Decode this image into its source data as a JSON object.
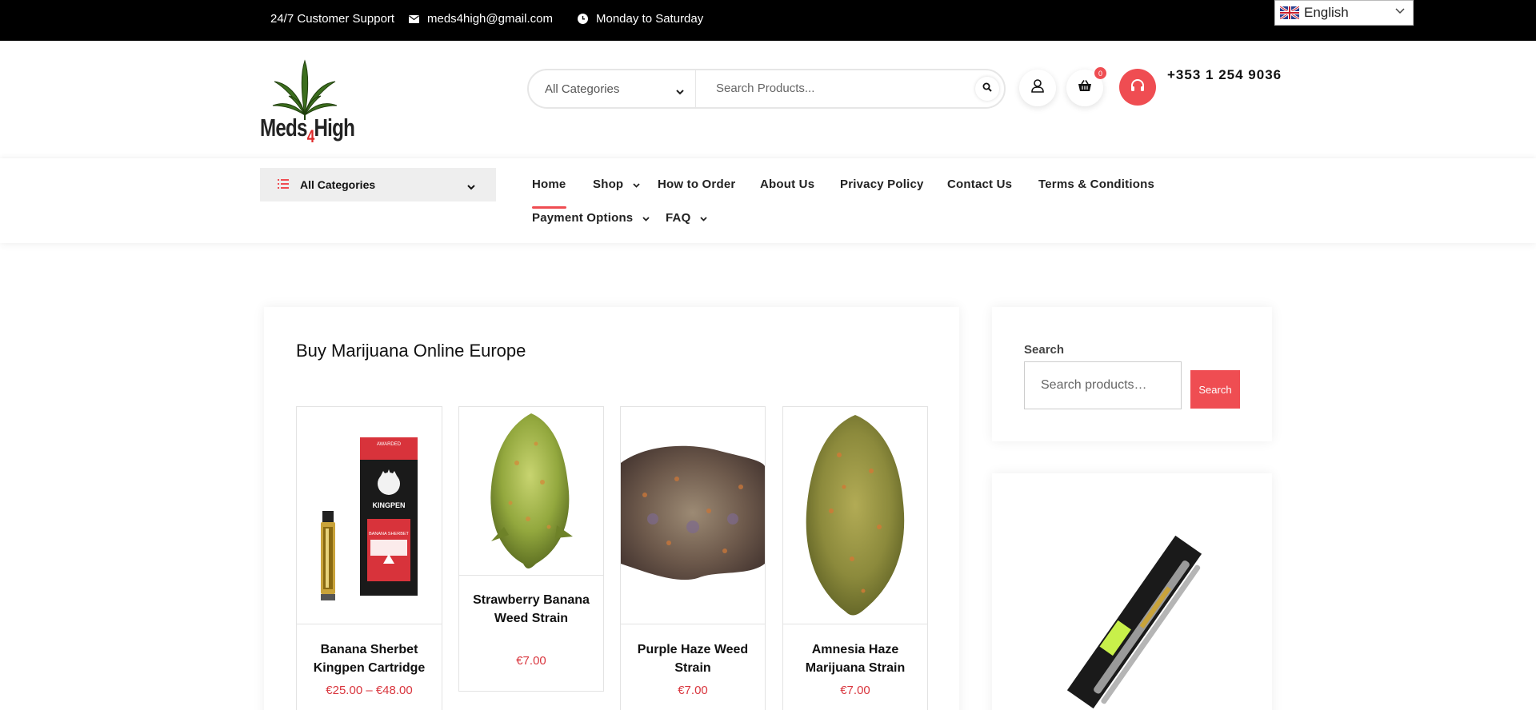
{
  "topbar": {
    "support": "24/7 Customer Support",
    "email": "meds4high@gmail.com",
    "hours": "Monday to Saturday",
    "language": "English"
  },
  "header": {
    "brand_a": "Meds",
    "brand_b": "4",
    "brand_c": "High",
    "category_select": "All Categories",
    "search_placeholder": "Search Products...",
    "cart_count": "0",
    "phone": "+353 1 254 9036"
  },
  "nav": {
    "all_categories": "All Categories",
    "items": [
      "Home",
      "Shop",
      "How to Order",
      "About Us",
      "Privacy Policy",
      "Contact Us",
      "Terms & Conditions",
      "Payment Options",
      "FAQ"
    ]
  },
  "main": {
    "title": "Buy Marijuana Online Europe",
    "products": [
      {
        "name": "Banana Sherbet Kingpen Cartridge",
        "price": "€25.00 – €48.00",
        "pack_brand": "KINGPEN",
        "pack_flavor": "BANANA SHERBET",
        "pack_award": "AWARDED"
      },
      {
        "name": "Strawberry Banana Weed Strain",
        "price": "€7.00"
      },
      {
        "name": "Purple Haze Weed Strain",
        "price": "€7.00"
      },
      {
        "name": "Amnesia Haze Marijuana Strain",
        "price": "€7.00"
      }
    ]
  },
  "sidebar": {
    "search_label": "Search",
    "search_placeholder": "Search products…",
    "search_button": "Search"
  },
  "colors": {
    "accent": "#ef4d52",
    "price": "#d9363e",
    "topbar_bg": "#000000"
  }
}
